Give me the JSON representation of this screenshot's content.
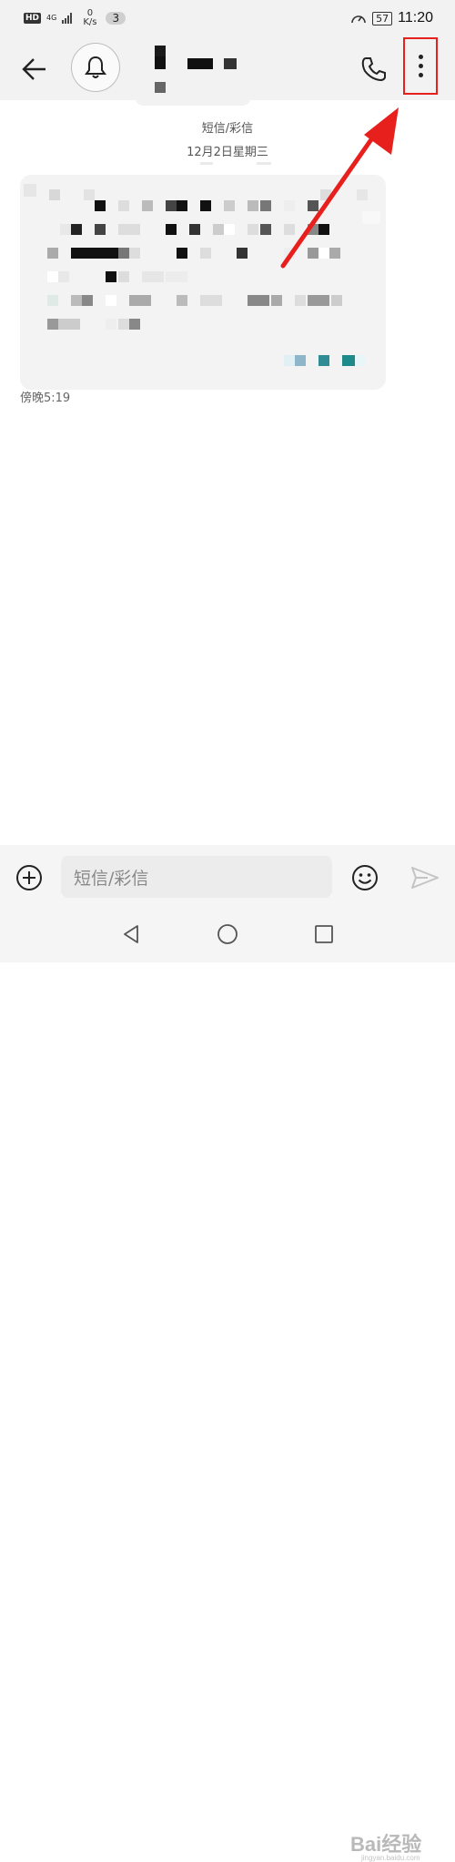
{
  "status_bar": {
    "hd": "HD",
    "network": "4G",
    "speed_value": "0",
    "speed_unit": "K/s",
    "notification_count": "3",
    "battery": "57",
    "time": "11:20"
  },
  "header": {
    "icons": [
      "back-arrow-icon",
      "bell-icon",
      "phone-icon",
      "more-vertical-icon"
    ],
    "highlight_color": "#e8201d"
  },
  "conversation": {
    "channel": "短信/彩信",
    "date": "12月2日星期三",
    "message_time": "傍晚5:19"
  },
  "input_bar": {
    "placeholder": "短信/彩信",
    "icons": [
      "add-icon",
      "emoji-icon",
      "send-icon"
    ]
  },
  "nav_bar": {
    "icons": [
      "nav-back-icon",
      "nav-home-icon",
      "nav-recent-icon"
    ]
  },
  "watermark": {
    "text": "Bai经验",
    "subtext": "jingyan.baidu.com"
  },
  "colors": {
    "annotation_red": "#e8201d",
    "header_bg": "#f2f2f2",
    "bubble_bg": "#f3f3f3"
  }
}
